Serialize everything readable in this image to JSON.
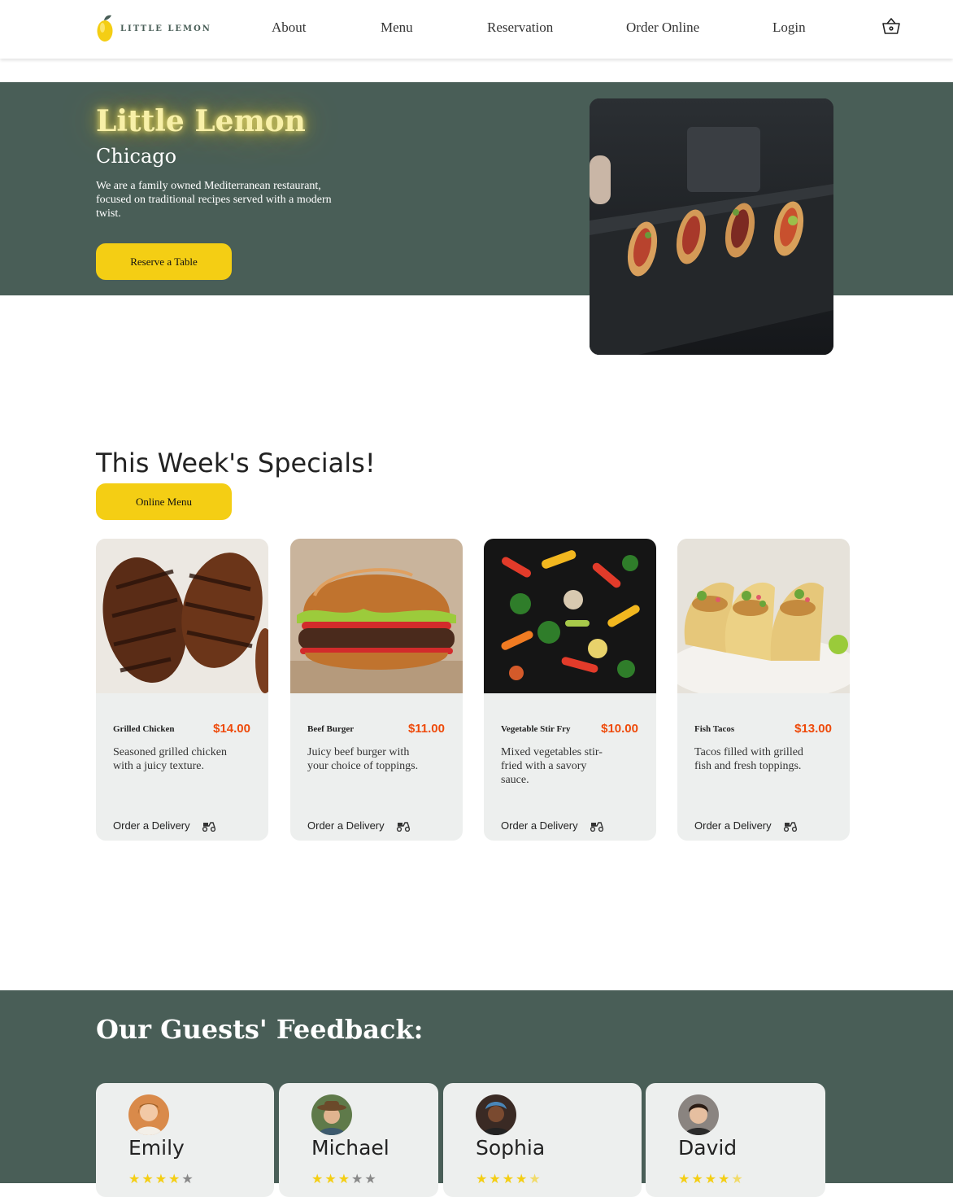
{
  "nav": {
    "brand": "LITTLE LEMON",
    "links": [
      "About",
      "Menu",
      "Reservation",
      "Order Online",
      "Login"
    ]
  },
  "hero": {
    "title": "Little Lemon",
    "subtitle": "Chicago",
    "description": "We are a family owned Mediterranean restaurant, focused on traditional recipes served with a modern twist.",
    "button": "Reserve a Table"
  },
  "specials": {
    "title": "This Week's Specials!",
    "button": "Online Menu",
    "order_label": "Order a Delivery",
    "items": [
      {
        "name": "Grilled Chicken",
        "price": "$14.00",
        "description": "Seasoned grilled chicken with a juicy texture."
      },
      {
        "name": "Beef Burger",
        "price": "$11.00",
        "description": "Juicy beef burger with your choice of toppings."
      },
      {
        "name": "Vegetable Stir Fry",
        "price": "$10.00",
        "description": "Mixed vegetables stir-fried with a savory sauce."
      },
      {
        "name": "Fish Tacos",
        "price": "$13.00",
        "description": "Tacos filled with grilled fish and fresh toppings."
      }
    ]
  },
  "feedback": {
    "title": "Our Guests' Feedback:",
    "reviews": [
      {
        "name": "Emily",
        "rating": 4
      },
      {
        "name": "Michael",
        "rating": 3
      },
      {
        "name": "Sophia",
        "rating": 4.5
      },
      {
        "name": "David",
        "rating": 4.5
      }
    ]
  },
  "colors": {
    "primary_green": "#495e57",
    "primary_yellow": "#f4ce14",
    "price_red": "#ee4a0a",
    "card_bg": "#edefee"
  },
  "icons": [
    "lemon-logo-icon",
    "basket-icon",
    "delivery-scooter-icon",
    "star-icon"
  ]
}
